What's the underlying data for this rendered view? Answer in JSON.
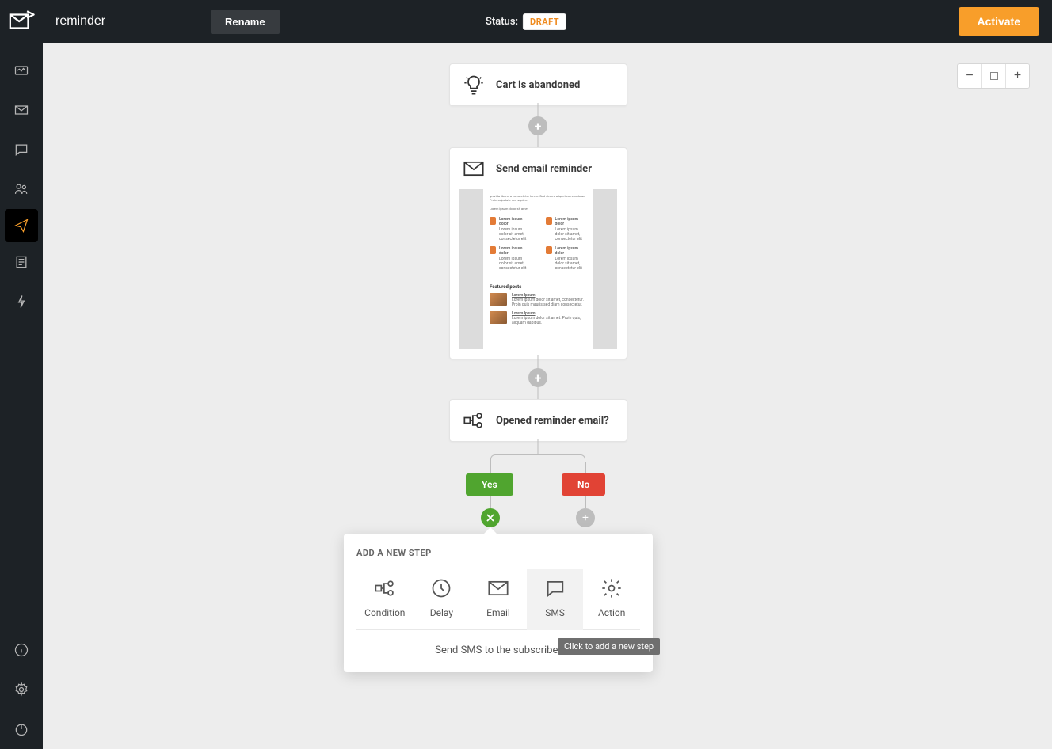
{
  "header": {
    "title_value": "reminder",
    "rename_label": "Rename",
    "status_label": "Status:",
    "status_badge": "DRAFT",
    "activate_label": "Activate"
  },
  "zoom": {
    "minus": "−",
    "plus": "+"
  },
  "nodes": {
    "trigger": {
      "title": "Cart is abandoned"
    },
    "email": {
      "title": "Send email reminder"
    },
    "condition": {
      "title": "Opened reminder email?"
    }
  },
  "email_preview": {
    "featured_heading": "Featured posts",
    "post_title": "Lorem Ipsum",
    "item_title": "Lorem ipsum dolor"
  },
  "branch": {
    "yes": "Yes",
    "no": "No"
  },
  "popup": {
    "title": "ADD A NEW STEP",
    "options": {
      "condition": "Condition",
      "delay": "Delay",
      "email": "Email",
      "sms": "SMS",
      "action": "Action"
    },
    "description": "Send SMS to the subscriber"
  },
  "tooltip": {
    "add_step": "Click to add a new step"
  }
}
